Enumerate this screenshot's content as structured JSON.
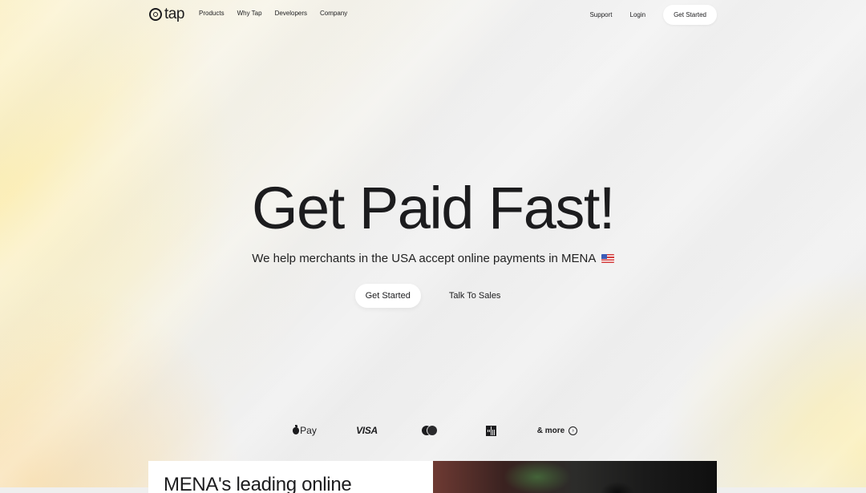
{
  "nav": {
    "logo_text": "tap",
    "links": [
      "Products",
      "Why Tap",
      "Developers",
      "Company"
    ],
    "support": "Support",
    "login": "Login",
    "get_started": "Get Started"
  },
  "hero": {
    "title": "Get Paid Fast!",
    "subtitle": "We help merchants in the USA accept online payments in MENA",
    "primary_button": "Get Started",
    "secondary_button": "Talk To Sales"
  },
  "payments": {
    "apple_pay": "Pay",
    "visa": "VISA",
    "more": "& more"
  },
  "panels": {
    "left_title": "MENA's leading online"
  },
  "colors": {
    "text": "#1c1c1e",
    "button_bg": "#ffffff"
  }
}
